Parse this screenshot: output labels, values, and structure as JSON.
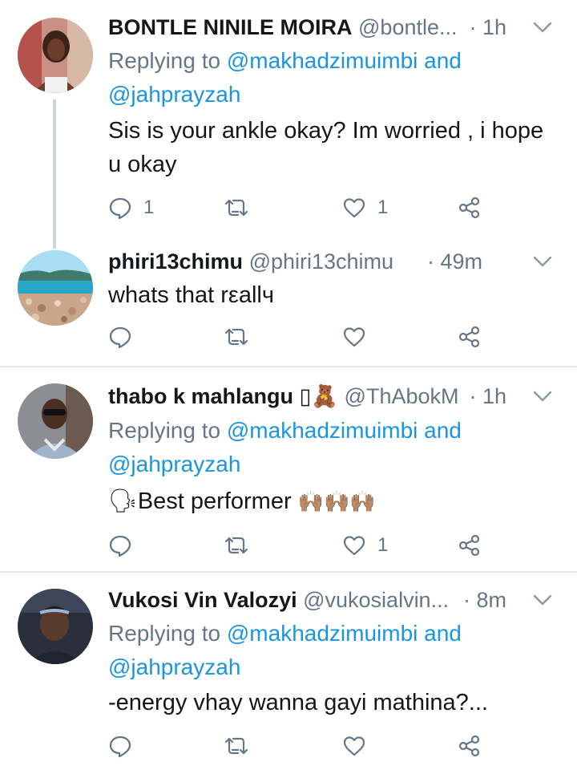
{
  "tweets": [
    {
      "name": "BONTLE NINILE MOIRA",
      "handle": "@bontle...",
      "time": "· 1h",
      "reply_prefix": "Replying to",
      "reply_mention1": "@makhadzimuimbi",
      "reply_and": "and",
      "reply_mention2": "@jahprayzah",
      "body_line1": "Sis is your ankle okay? Im worried , i hope",
      "body_line2": "u okay",
      "reply_count": "1",
      "like_count": "1"
    },
    {
      "name": "phiri13chimu",
      "handle": "@phiri13chimu",
      "time": "· 49m",
      "body": "whats that rεallч",
      "reply_count": "",
      "like_count": ""
    },
    {
      "name": "thabo k mahlangu",
      "name_emoji": "▯🧸",
      "handle": "@ThAbokM",
      "time": "· 1h",
      "reply_prefix": "Replying to",
      "reply_mention1": "@makhadzimuimbi",
      "reply_and": "and",
      "reply_mention2": "@jahprayzah",
      "body_prefix_emoji": "🗣",
      "body": "Best performer",
      "body_suffix_emoji": "🙌🏽🙌🏽🙌🏽",
      "reply_count": "",
      "like_count": "1"
    },
    {
      "name": "Vukosi Vin Valozyi",
      "handle": "@vukosialvin...",
      "time": "· 8m",
      "reply_prefix": "Replying to",
      "reply_mention1": "@makhadzimuimbi",
      "reply_and": "and",
      "reply_mention2": "@jahprayzah",
      "body": "-energy vhay wanna gayi mathina?...",
      "reply_count": "",
      "like_count": ""
    }
  ],
  "icons": {
    "reply": "reply-icon",
    "retweet": "retweet-icon",
    "like": "heart-icon",
    "share": "share-icon",
    "more": "chevron-down-icon"
  },
  "colors": {
    "text": "#14171a",
    "secondary": "#657786",
    "link": "#1b95e0",
    "divider": "#e1e8ed",
    "thread_line": "#ccd6dd"
  }
}
